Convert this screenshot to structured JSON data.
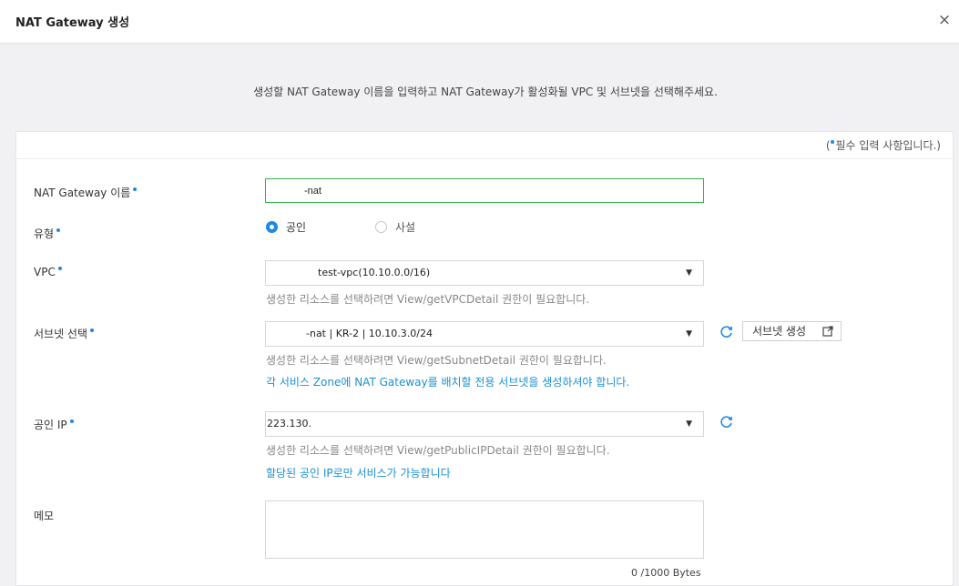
{
  "header": {
    "title": "NAT Gateway 생성",
    "close_icon": "×"
  },
  "description": "생성할 NAT Gateway 이름을 입력하고 NAT Gateway가 활성화될 VPC 및 서브넷을 선택해주세요.",
  "required_note": {
    "open": "(",
    "text": "필수 입력 사항입니다.)"
  },
  "fields": {
    "name": {
      "label": "NAT Gateway 이름",
      "value": "-nat"
    },
    "type": {
      "label": "유형",
      "options": [
        "공인",
        "사설"
      ],
      "selected": "공인"
    },
    "vpc": {
      "label": "VPC",
      "value": "test-vpc(10.10.0.0/16)",
      "help": "생성한 리소스를 선택하려면 View/getVPCDetail 권한이 필요합니다."
    },
    "subnet": {
      "label": "서브넷 선택",
      "value": "-nat | KR-2 | 10.10.3.0/24",
      "help": "생성한 리소스를 선택하려면 View/getSubnetDetail 권한이 필요합니다.",
      "notice": "각 서비스 Zone에 NAT Gateway를 배치할 전용 서브넷을 생성하셔야 합니다.",
      "create_button": "서브넷 생성"
    },
    "public_ip": {
      "label": "공인 IP",
      "value": "223.130.",
      "help": "생성한 리소스를 선택하려면 View/getPublicIPDetail 권한이 필요합니다.",
      "notice": "할당된 공인 IP로만 서비스가 가능합니다"
    },
    "memo": {
      "label": "메모",
      "value": "",
      "counter": "0 /1000 Bytes"
    }
  },
  "colors": {
    "accent": "#1e88e5",
    "valid_border": "#2fb24a",
    "link_blue": "#1a8fd6"
  },
  "icons": {
    "refresh": "refresh-icon",
    "external": "external-link-icon",
    "caret": "caret-down-icon"
  }
}
